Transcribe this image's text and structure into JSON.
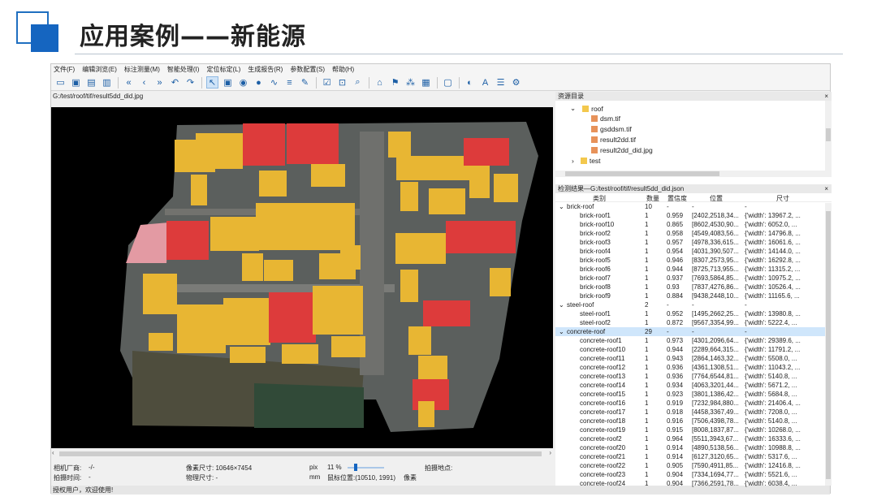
{
  "slide": {
    "title": "应用案例——新能源"
  },
  "app": {
    "menu": [
      "文件(F)",
      "编辑浏览(E)",
      "标注测量(M)",
      "智能处理(I)",
      "定位标定(L)",
      "生成报告(R)",
      "参数配置(S)",
      "帮助(H)"
    ],
    "image_path": "G:/test/roof/tif/result5dd_did.jpg",
    "status": {
      "camera_vendor_label": "相机厂商:",
      "camera_vendor_value": "-/-",
      "shoot_time_label": "拍摄时间:",
      "shoot_time_value": "-",
      "pixel_size": "像素尺寸: 10646×7454",
      "physical_size": "物理尺寸: -",
      "unit_px": "pix",
      "unit_mm": "mm",
      "zoom": "11 %",
      "mouse_pos": "鼠标位置:(10510, 1991)",
      "pixel_unit": "像素",
      "location": "拍摄地点:",
      "zoom_level": 0.11
    },
    "statusbar": "授权用户，欢迎使用!"
  },
  "resources": {
    "title": "资源目录",
    "close": "×",
    "items": [
      {
        "label": "roof",
        "type": "folder"
      },
      {
        "label": "dsm.tif",
        "type": "file"
      },
      {
        "label": "gsddsm.tif",
        "type": "file"
      },
      {
        "label": "result2dd.tif",
        "type": "file"
      },
      {
        "label": "result2dd_did.jpg",
        "type": "file"
      },
      {
        "label": "test",
        "type": "folder"
      }
    ]
  },
  "results": {
    "title": "检测结果—G:/test/roof/tif/result5dd_did.json",
    "close": "×",
    "headers": [
      "类别",
      "数量",
      "置信度",
      "位置",
      "尺寸"
    ],
    "rows": [
      {
        "level": 0,
        "name": "brick-roof",
        "n": "10",
        "conf": "-",
        "pos": "-",
        "size": "-"
      },
      {
        "level": 1,
        "name": "brick-roof1",
        "n": "1",
        "conf": "0.959",
        "pos": "[2402,2518,34...",
        "size": "{'width': 13967.2, ..."
      },
      {
        "level": 1,
        "name": "brick-roof10",
        "n": "1",
        "conf": "0.865",
        "pos": "[8602,4530,90...",
        "size": "{'width': 6052.0, ..."
      },
      {
        "level": 1,
        "name": "brick-roof2",
        "n": "1",
        "conf": "0.958",
        "pos": "[4549,4083,56...",
        "size": "{'width': 14796.8, ..."
      },
      {
        "level": 1,
        "name": "brick-roof3",
        "n": "1",
        "conf": "0.957",
        "pos": "[4978,336,615...",
        "size": "{'width': 16061.6, ..."
      },
      {
        "level": 1,
        "name": "brick-roof4",
        "n": "1",
        "conf": "0.954",
        "pos": "[4031,390,507...",
        "size": "{'width': 14144.0, ..."
      },
      {
        "level": 1,
        "name": "brick-roof5",
        "n": "1",
        "conf": "0.946",
        "pos": "[8307,2573,95...",
        "size": "{'width': 16292.8, ..."
      },
      {
        "level": 1,
        "name": "brick-roof6",
        "n": "1",
        "conf": "0.944",
        "pos": "[8725,713,955...",
        "size": "{'width': 11315.2, ..."
      },
      {
        "level": 1,
        "name": "brick-roof7",
        "n": "1",
        "conf": "0.937",
        "pos": "[7693,5864,85...",
        "size": "{'width': 10975.2, ..."
      },
      {
        "level": 1,
        "name": "brick-roof8",
        "n": "1",
        "conf": "0.93",
        "pos": "[7837,4276,86...",
        "size": "{'width': 10526.4, ..."
      },
      {
        "level": 1,
        "name": "brick-roof9",
        "n": "1",
        "conf": "0.884",
        "pos": "[9438,2448,10...",
        "size": "{'width': 11165.6, ..."
      },
      {
        "level": 0,
        "name": "steel-roof",
        "n": "2",
        "conf": "-",
        "pos": "-",
        "size": "-"
      },
      {
        "level": 1,
        "name": "steel-roof1",
        "n": "1",
        "conf": "0.952",
        "pos": "[1495,2662,25...",
        "size": "{'width': 13980.8, ..."
      },
      {
        "level": 1,
        "name": "steel-roof2",
        "n": "1",
        "conf": "0.872",
        "pos": "[9567,3354,99...",
        "size": "{'width': 5222.4, ..."
      },
      {
        "level": 0,
        "name": "concrete-roof",
        "n": "29",
        "conf": "-",
        "pos": "-",
        "size": "-",
        "selected": true
      },
      {
        "level": 1,
        "name": "concrete-roof1",
        "n": "1",
        "conf": "0.973",
        "pos": "[4301,2096,64...",
        "size": "{'width': 29389.6, ..."
      },
      {
        "level": 1,
        "name": "concrete-roof10",
        "n": "1",
        "conf": "0.944",
        "pos": "[2289,664,315...",
        "size": "{'width': 11791.2, ..."
      },
      {
        "level": 1,
        "name": "concrete-roof11",
        "n": "1",
        "conf": "0.943",
        "pos": "[2864,1463,32...",
        "size": "{'width': 5508.0, ..."
      },
      {
        "level": 1,
        "name": "concrete-roof12",
        "n": "1",
        "conf": "0.936",
        "pos": "[4361,1308,51...",
        "size": "{'width': 11043.2, ..."
      },
      {
        "level": 1,
        "name": "concrete-roof13",
        "n": "1",
        "conf": "0.936",
        "pos": "[7764,6544,81...",
        "size": "{'width': 5140.8, ..."
      },
      {
        "level": 1,
        "name": "concrete-roof14",
        "n": "1",
        "conf": "0.934",
        "pos": "[4063,3201,44...",
        "size": "{'width': 5671.2, ..."
      },
      {
        "level": 1,
        "name": "concrete-roof15",
        "n": "1",
        "conf": "0.923",
        "pos": "[3801,1386,42...",
        "size": "{'width': 5684.8, ..."
      },
      {
        "level": 1,
        "name": "concrete-roof16",
        "n": "1",
        "conf": "0.919",
        "pos": "[7232,984,880...",
        "size": "{'width': 21406.4, ..."
      },
      {
        "level": 1,
        "name": "concrete-roof17",
        "n": "1",
        "conf": "0.918",
        "pos": "[4458,3367,49...",
        "size": "{'width': 7208.0, ..."
      },
      {
        "level": 1,
        "name": "concrete-roof18",
        "n": "1",
        "conf": "0.916",
        "pos": "[7506,4398,78...",
        "size": "{'width': 5140.8, ..."
      },
      {
        "level": 1,
        "name": "concrete-roof19",
        "n": "1",
        "conf": "0.915",
        "pos": "[8008,1837,87...",
        "size": "{'width': 10268.0, ..."
      },
      {
        "level": 1,
        "name": "concrete-roof2",
        "n": "1",
        "conf": "0.964",
        "pos": "[5511,3943,67...",
        "size": "{'width': 16333.6, ..."
      },
      {
        "level": 1,
        "name": "concrete-roof20",
        "n": "1",
        "conf": "0.914",
        "pos": "[4890,5138,56...",
        "size": "{'width': 10988.8, ..."
      },
      {
        "level": 1,
        "name": "concrete-roof21",
        "n": "1",
        "conf": "0.914",
        "pos": "[6127,3120,65...",
        "size": "{'width': 5317.6, ..."
      },
      {
        "level": 1,
        "name": "concrete-roof22",
        "n": "1",
        "conf": "0.905",
        "pos": "[7590,4911,85...",
        "size": "{'width': 12416.8, ..."
      },
      {
        "level": 1,
        "name": "concrete-roof23",
        "n": "1",
        "conf": "0.904",
        "pos": "[7334,1694,77...",
        "size": "{'width': 5521.6, ..."
      },
      {
        "level": 1,
        "name": "concrete-roof24",
        "n": "1",
        "conf": "0.904",
        "pos": "[7366,2591,78...",
        "size": "{'width': 6038.4, ..."
      }
    ]
  },
  "colors": {
    "concrete": "#e8b633",
    "brick": "#dd3b3b",
    "steel": "#e39aa3",
    "accent": "#1565c0"
  },
  "icons": [
    "open-folder-icon",
    "image-icon",
    "save-icon",
    "save-as-icon",
    "first-icon",
    "prev-icon",
    "next-icon",
    "undo-icon",
    "redo-icon",
    "pointer-icon",
    "rect-select-icon",
    "circle-icon",
    "point-icon",
    "polyline-icon",
    "text-icon",
    "pencil-icon",
    "checkbox-icon",
    "zoom-fit-icon",
    "zoom-icon",
    "measure-icon",
    "locate-icon",
    "network-icon",
    "qr-icon",
    "report-icon",
    "palette-icon",
    "font-icon",
    "list-icon",
    "gear-icon"
  ]
}
